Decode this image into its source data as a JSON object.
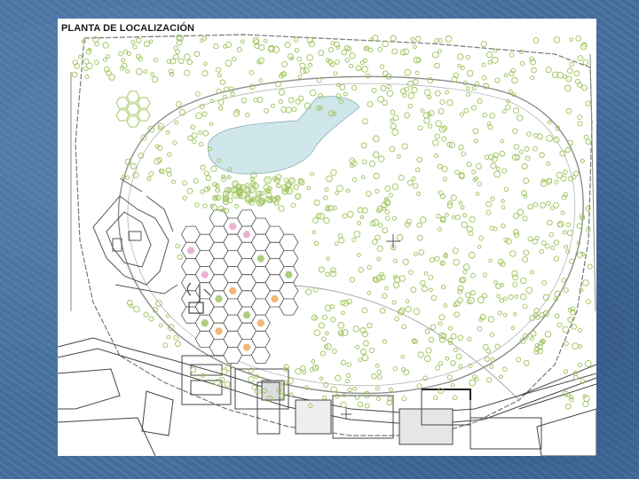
{
  "slide": {
    "background_color": "#46709f"
  },
  "map": {
    "title": "PLANTA DE LOCALIZACIÓN",
    "colors": {
      "vegetation": "#9cc25a",
      "lake": "#cfe6ea",
      "lines": "#6e6e6e",
      "hex_outline": "#555555",
      "hex_pink": "#e7b3cf",
      "hex_orange": "#f2b679",
      "hex_green": "#a9cf7e"
    },
    "icons": [
      "north-cross-icon",
      "building-block-icon",
      "hexagon-garden-icon"
    ]
  }
}
